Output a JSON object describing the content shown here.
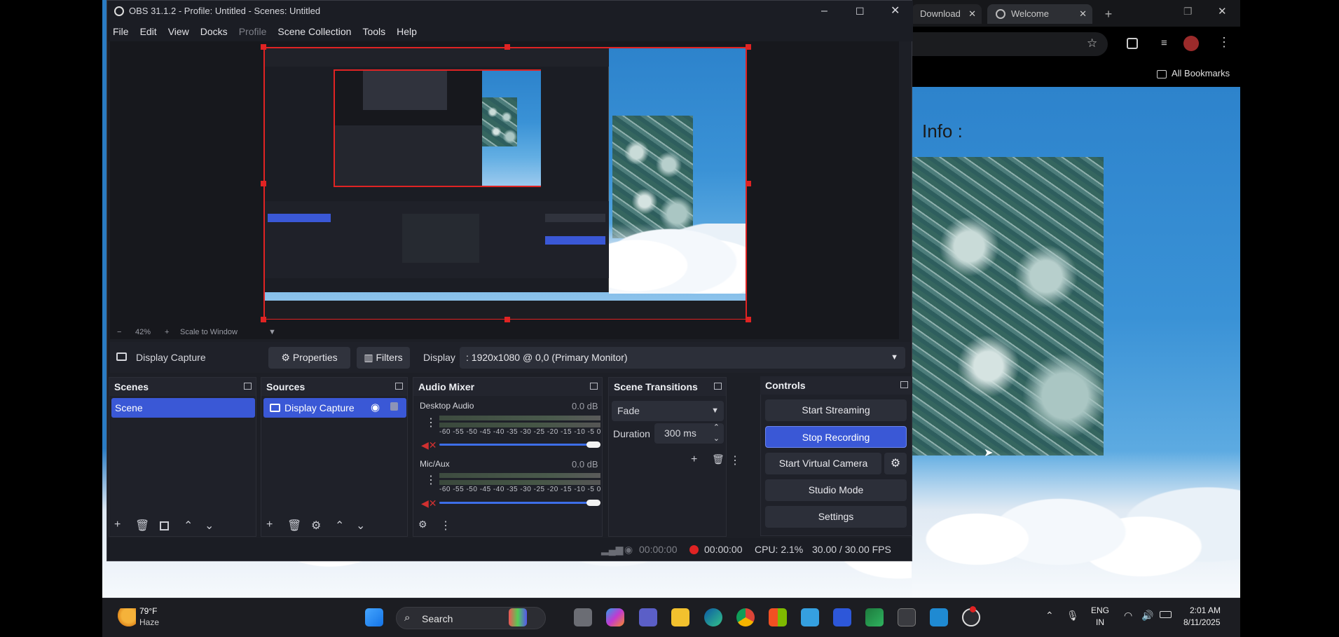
{
  "obs": {
    "title": "OBS 31.1.2 - Profile: Untitled - Scenes: Untitled",
    "menu": [
      "File",
      "Edit",
      "View",
      "Docks",
      "Profile",
      "Scene Collection",
      "Tools",
      "Help"
    ],
    "zoom": {
      "minus": "−",
      "level": "42%",
      "plus": "+",
      "scale_label": "Scale to Window"
    },
    "source_bar": {
      "source_name": "Display Capture",
      "properties": "Properties",
      "filters": "Filters",
      "display_label": "Display",
      "display_value": ": 1920x1080 @ 0,0 (Primary Monitor)"
    },
    "scenes": {
      "header": "Scenes",
      "items": [
        "Scene"
      ]
    },
    "sources": {
      "header": "Sources",
      "items": [
        "Display Capture"
      ]
    },
    "audio": {
      "header": "Audio Mixer",
      "channels": [
        {
          "name": "Desktop Audio",
          "level": "0.0 dB"
        },
        {
          "name": "Mic/Aux",
          "level": "0.0 dB"
        }
      ],
      "scale": "-60 -55 -50 -45 -40 -35 -30 -25 -20 -15 -10 -5 0"
    },
    "transitions": {
      "header": "Scene Transitions",
      "type": "Fade",
      "duration_label": "Duration",
      "duration_value": "300 ms"
    },
    "controls": {
      "header": "Controls",
      "start_streaming": "Start Streaming",
      "stop_recording": "Stop Recording",
      "start_virtual_camera": "Start Virtual Camera",
      "studio_mode": "Studio Mode",
      "settings": "Settings"
    },
    "status": {
      "stream_time": "00:00:00",
      "record_time": "00:00:00",
      "cpu": "CPU: 2.1%",
      "fps": "30.00 / 30.00 FPS"
    }
  },
  "browser": {
    "tabs": [
      "Download",
      "Welcome"
    ],
    "bookmarks": "All Bookmarks",
    "page_heading": "Info :"
  },
  "taskbar": {
    "weather_temp": "79°F",
    "weather_desc": "Haze",
    "search": "Search",
    "lang1": "ENG",
    "lang2": "IN",
    "time": "2:01 AM",
    "date": "8/11/2025"
  },
  "colors": {
    "accent": "#3a58d6",
    "record": "#e02323",
    "obs_bg": "#1d1f26",
    "desktop_sky": "#2d83cc"
  }
}
